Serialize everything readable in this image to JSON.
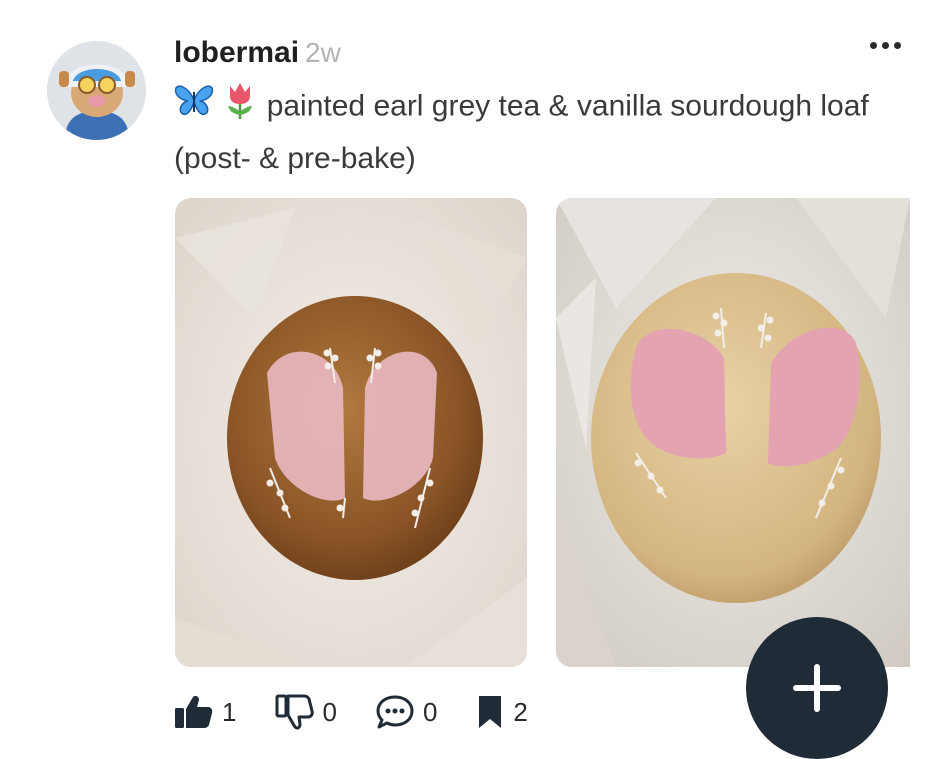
{
  "post": {
    "username": "lobermai",
    "age": "2w",
    "caption": "painted earl grey tea & vanilla sourdough loaf (post- & pre-bake)",
    "emojis": [
      "butterfly",
      "tulip"
    ],
    "images": [
      {
        "description_name": "baked-loaf-photo"
      },
      {
        "description_name": "unbaked-loaf-photo"
      }
    ]
  },
  "actions": {
    "upvotes": "1",
    "downvotes": "0",
    "comments": "0",
    "saves": "2"
  },
  "icons": [
    "avatar",
    "more-icon",
    "butterfly-icon",
    "tulip-icon",
    "thumbs-up-icon",
    "thumbs-down-icon",
    "comment-icon",
    "bookmark-icon",
    "plus-icon"
  ],
  "colors": {
    "fab": "#1f2b36",
    "age": "#b3b3b3"
  }
}
